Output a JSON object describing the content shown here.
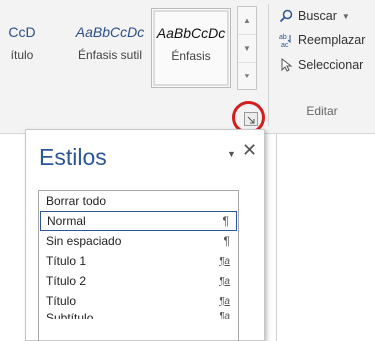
{
  "ribbon": {
    "styles_gallery": [
      {
        "sample": "CcD",
        "name": "ítulo"
      },
      {
        "sample": "AaBbCcDc",
        "name": "Énfasis sutil"
      },
      {
        "sample": "AaBbCcDc",
        "name": "Énfasis"
      }
    ],
    "gallery_arrows": [
      "▲",
      "▼",
      "⯆"
    ],
    "editing": {
      "search_label": "Buscar",
      "replace_label": "Reemplazar",
      "select_label": "Seleccionar",
      "group_label": "Editar",
      "dropdown_caret": "▼"
    }
  },
  "styles_pane": {
    "title": "Estilos",
    "menu_caret": "▼",
    "close": "✕",
    "items": [
      {
        "label": "Borrar todo",
        "mark": ""
      },
      {
        "label": "Normal",
        "mark": "¶"
      },
      {
        "label": "Sin espaciado",
        "mark": "¶"
      },
      {
        "label": "Título 1",
        "mark": "¶a"
      },
      {
        "label": "Título 2",
        "mark": "¶a"
      },
      {
        "label": "Título",
        "mark": "¶a"
      },
      {
        "label": "Subtítulo",
        "mark": "¶a"
      }
    ]
  },
  "colors": {
    "accent": "#2b579a",
    "highlight_circle": "#d31e1e"
  }
}
